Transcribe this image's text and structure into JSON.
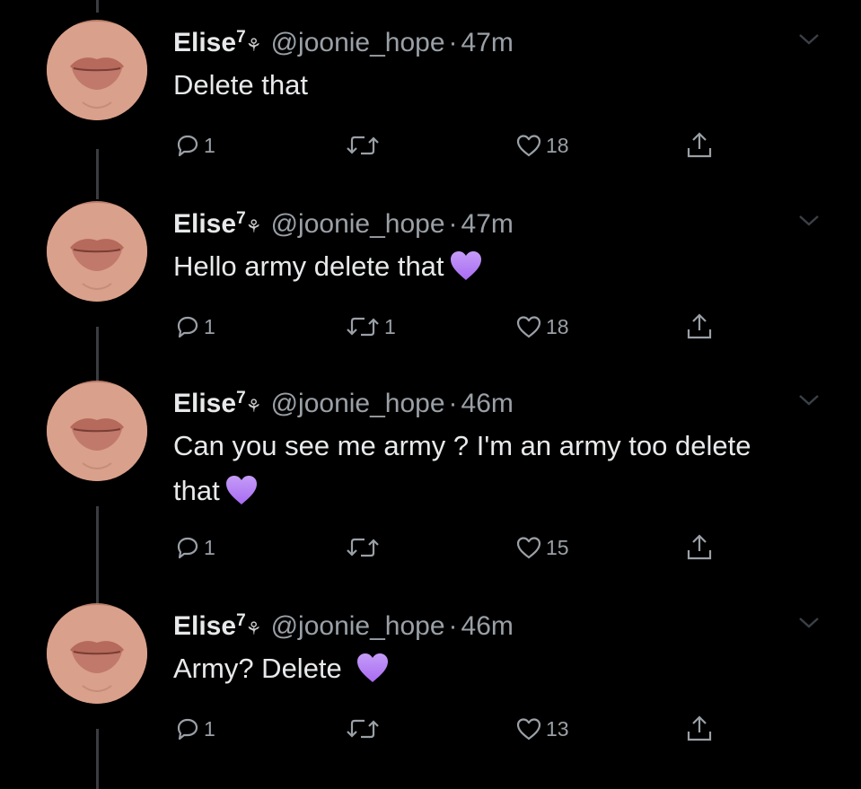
{
  "colors": {
    "background": "#000000",
    "text": "#e7e9ea",
    "muted": "#9aa0a6",
    "heart_emoji": "#a86bf2"
  },
  "tweets": [
    {
      "name": "Elise",
      "name_sup": "7",
      "name_emoji": "⚘",
      "handle": "@joonie_hope",
      "dot": "·",
      "time": "47m",
      "text": "Delete that",
      "heart_emoji_icon": "purple-heart-icon",
      "replies": "1",
      "retweets": "",
      "likes": "18"
    },
    {
      "name": "Elise",
      "name_sup": "7",
      "name_emoji": "⚘",
      "handle": "@joonie_hope",
      "dot": "·",
      "time": "47m",
      "text": "Hello army delete that",
      "heart_emoji_icon": "purple-heart-icon",
      "replies": "1",
      "retweets": "1",
      "likes": "18"
    },
    {
      "name": "Elise",
      "name_sup": "7",
      "name_emoji": "⚘",
      "handle": "@joonie_hope",
      "dot": "·",
      "time": "46m",
      "text": "Can you see me army ? I'm an army too delete that",
      "heart_emoji_icon": "purple-heart-icon",
      "replies": "1",
      "retweets": "",
      "likes": "15"
    },
    {
      "name": "Elise",
      "name_sup": "7",
      "name_emoji": "⚘",
      "handle": "@joonie_hope",
      "dot": "·",
      "time": "46m",
      "text": "Army? Delete",
      "heart_emoji_icon": "purple-heart-icon",
      "replies": "1",
      "retweets": "",
      "likes": "13"
    }
  ]
}
